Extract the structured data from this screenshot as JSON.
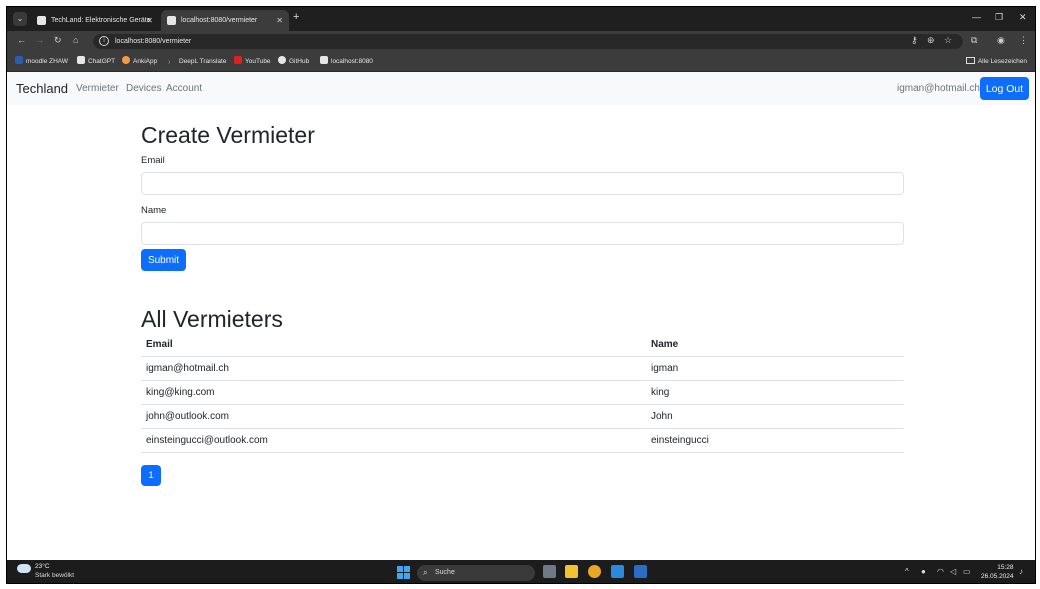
{
  "browser": {
    "tabs": [
      {
        "title": "TechLand: Elektronische Geräte"
      },
      {
        "title": "localhost:8080/vermieter"
      }
    ],
    "url": "localhost:8080/vermieter",
    "bookmarks": [
      "moodle ZHAW",
      "ChatGPT",
      "AnkiApp",
      "DeepL Translate",
      "YouTube",
      "GitHub",
      "localhost:8080"
    ],
    "all_bookmarks": "Alle Lesezeichen"
  },
  "navbar": {
    "brand": "Techland",
    "links": [
      "Vermieter",
      "Devices",
      "Account"
    ],
    "user_email": "igman@hotmail.ch",
    "logout_label": "Log Out"
  },
  "create_form": {
    "title": "Create Vermieter",
    "email_label": "Email",
    "email_value": "",
    "name_label": "Name",
    "name_value": "",
    "submit_label": "Submit"
  },
  "list": {
    "title": "All Vermieters",
    "columns": [
      "Email",
      "Name"
    ],
    "rows": [
      {
        "email": "igman@hotmail.ch",
        "name": "igman"
      },
      {
        "email": "king@king.com",
        "name": "king"
      },
      {
        "email": "john@outlook.com",
        "name": "John"
      },
      {
        "email": "einsteingucci@outlook.com",
        "name": "einsteingucci"
      }
    ],
    "page": "1"
  },
  "taskbar": {
    "temperature": "23°C",
    "weather": "Stark bewölkt",
    "search_placeholder": "Suche",
    "time": "15:28",
    "date": "26.05.2024"
  },
  "colors": {
    "primary": "#0d6efd",
    "navbar_bg": "#f8f9fa",
    "browser_dark": "#3c3c3c"
  }
}
